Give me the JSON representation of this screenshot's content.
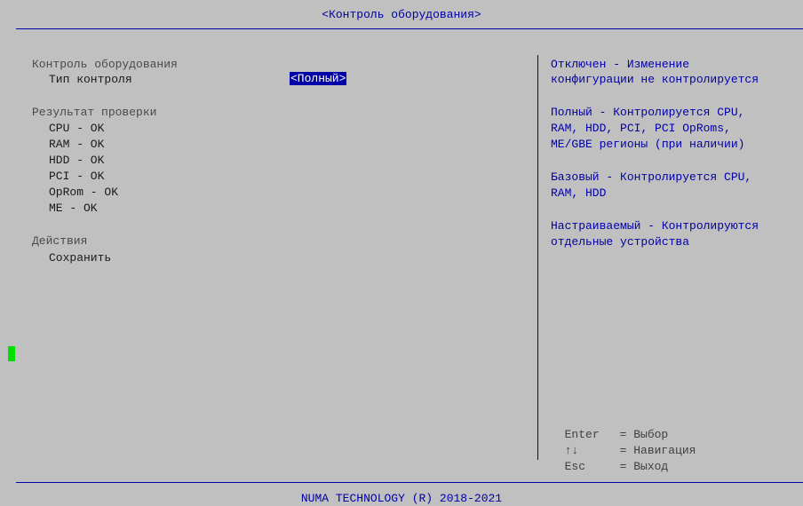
{
  "window": {
    "title": "<Контроль оборудования>"
  },
  "main": {
    "section_control": "Контроль оборудования",
    "control_type_label": "Тип контроля",
    "control_type_value": "<Полный>",
    "section_result": "Результат проверки",
    "results": [
      "CPU - OK",
      "RAM - OK",
      "HDD - OK",
      "PCI - OK",
      "OpRom - OK",
      "ME - OK"
    ],
    "section_actions": "Действия",
    "save_label": "Сохранить"
  },
  "help": {
    "lines": [
      "Отключен - Изменение",
      "конфигурации не контролируется",
      "Полный - Контролируется CPU,",
      "RAM, HDD, PCI, PCI OpRoms,",
      "ME/GBE регионы (при наличии)",
      "Базовый - Контролируется CPU,",
      "RAM, HDD",
      "Настраиваемый - Контролируются",
      "отдельные устройства"
    ],
    "keys": [
      {
        "key": "Enter",
        "desc": "= Выбор"
      },
      {
        "key": "↑↓",
        "desc": "= Навигация"
      },
      {
        "key": "Esc",
        "desc": "= Выход"
      }
    ]
  },
  "footer": {
    "text": "NUMA TECHNOLOGY (R) 2018-2021"
  },
  "colors": {
    "background": "#c0c0c0",
    "accent": "#0000a8",
    "cursor": "#00e000"
  }
}
